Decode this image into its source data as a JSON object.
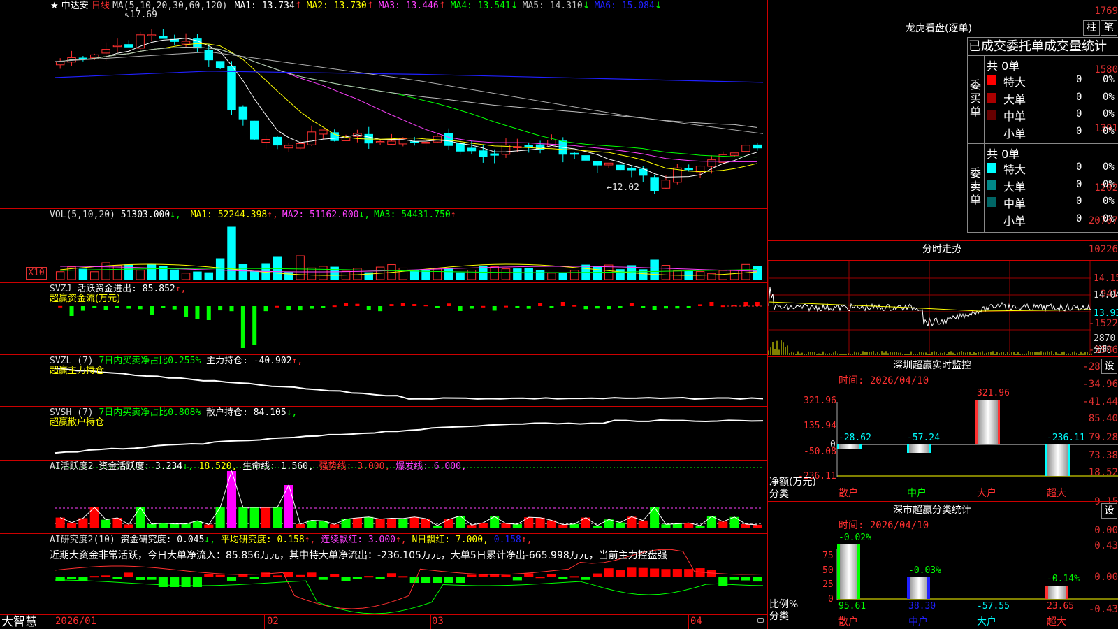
{
  "kline": {
    "star": "★",
    "stock_name": "中达安",
    "period": "日线",
    "ma_title": "MA(5,10,20,30,60,120)",
    "ma": [
      {
        "label": "MA1: 13.734",
        "arrow": "↑",
        "color": "#ffffff"
      },
      {
        "label": "MA2: 13.730",
        "arrow": "↑",
        "color": "#ffff00"
      },
      {
        "label": "MA3: 13.446",
        "arrow": "↑",
        "color": "#ff40ff"
      },
      {
        "label": "MA4: 13.541",
        "arrow": "↓",
        "color": "#00ff00"
      },
      {
        "label": "MA5: 14.310",
        "arrow": "↓",
        "color": "#c0c0c0"
      },
      {
        "label": "MA6: 15.084",
        "arrow": "↓",
        "color": "#2020ff"
      }
    ],
    "yaxis": [
      "1769",
      "1580",
      "1391",
      "1202"
    ],
    "high_mark": "17.69",
    "low_mark": "←12.02"
  },
  "vol": {
    "title": "VOL(5,10,20)",
    "value": "51303.000",
    "value_arrow": "↓,",
    "ma": [
      {
        "label": "MA1: 52244.398",
        "arrow": "↑,",
        "color": "#ffff00"
      },
      {
        "label": "MA2: 51162.000",
        "arrow": "↓,",
        "color": "#ff40ff"
      },
      {
        "label": "MA3: 54431.750",
        "arrow": "↑",
        "color": "#00ff00"
      }
    ],
    "yaxis": [
      "20707",
      "10226"
    ],
    "unit": "X10"
  },
  "svzj": {
    "title": "SVZJ",
    "label": "活跃资金进出: 85.852",
    "arrow": "↑,",
    "subtitle": "超赢资金流(万元)",
    "yaxis": [
      "941",
      "-1522",
      "-3986"
    ]
  },
  "svzl": {
    "title": "SVZL (7)",
    "ratio": "7日内买卖净占比0.255%",
    "label": "主力持仓: -40.902",
    "arrow": "↑,",
    "subtitle": "超赢主力持仓",
    "yaxis": [
      "-28.47",
      "-34.96",
      "-41.44"
    ]
  },
  "svsh": {
    "title": "SVSH (7)",
    "ratio": "7日内买卖净占比0.808%",
    "label": "散户持仓: 84.105",
    "arrow": "↓,",
    "subtitle": "超赢散户持仓",
    "yaxis": [
      "85.40",
      "79.28",
      "73.38"
    ]
  },
  "ai_active": {
    "title": "AI活跃度2",
    "fund": "资金活跃度: 3.234",
    "fund_arrow": "↓,",
    "v2": "18.520,",
    "life": "生命线: 1.560,",
    "strong": "强势线: 3.000,",
    "burst": "爆发线: 6.000,",
    "yaxis": [
      "18.52",
      "9.15",
      "0.00"
    ]
  },
  "ai_research": {
    "title": "AI研究度2(10)",
    "fund": "资金研究度: 0.045",
    "fund_arrow": "↓,",
    "avg": "平均研究度: 0.158",
    "avg_arrow": "↑,",
    "cont": "连续飘红: 3.000",
    "cont_arrow": "↑,",
    "n": "N日飘红: 7.000,",
    "last": "0.158",
    "last_arrow": "↑,",
    "desc": "近期大资金非常活跃，今日大单净流入：85.856万元，其中特大单净流出：-236.105万元，大单5日累计净出-665.998万元，当前主力控盘强",
    "yaxis": [
      "0.43",
      "0.00",
      "-0.43"
    ]
  },
  "bottom": {
    "app": "大智慧",
    "dates": [
      "2026/01",
      "02",
      "03",
      "04"
    ]
  },
  "lhb": {
    "title": "龙虎看盘(逐单)",
    "btn1": "柱",
    "btn2": "笔",
    "header": "已成交委托单成交量统计",
    "buy_label": "委买单",
    "sell_label": "委卖单",
    "buy_total": "共 0单",
    "sell_total": "共 0单",
    "buy_rows": [
      {
        "name": "特大",
        "count": "0",
        "pct": "0%",
        "color": "#ff0000"
      },
      {
        "name": "大单",
        "count": "0",
        "pct": "0%",
        "color": "#aa0000"
      },
      {
        "name": "中单",
        "count": "0",
        "pct": "0%",
        "color": "#660000"
      },
      {
        "name": "小单",
        "count": "0",
        "pct": "0%",
        "color": ""
      }
    ],
    "sell_rows": [
      {
        "name": "特大",
        "count": "0",
        "pct": "0%",
        "color": "#00ffff"
      },
      {
        "name": "大单",
        "count": "0",
        "pct": "0%",
        "color": "#008888"
      },
      {
        "name": "中单",
        "count": "0",
        "pct": "0%",
        "color": "#006666"
      },
      {
        "name": "小单",
        "count": "0",
        "pct": "0%",
        "color": ""
      }
    ]
  },
  "intraday": {
    "title": "分时走势",
    "yaxis": [
      "14.15",
      "14.04",
      "13.93"
    ],
    "vol": "2870",
    "vol_label": "分时"
  },
  "monitor": {
    "title": "深圳超赢实时监控",
    "btn": "设",
    "time": "时间: 2026/04/10",
    "yaxis": [
      "321.96",
      "135.94",
      "0",
      "-50.08",
      "-236.11"
    ],
    "bars": [
      {
        "name": "散户",
        "value": "-28.62"
      },
      {
        "name": "中户",
        "value": "-57.24"
      },
      {
        "name": "大户",
        "value": "321.96"
      },
      {
        "name": "超大",
        "value": "-236.11"
      }
    ],
    "left_label1": "净额(万元)",
    "left_label2": "分类"
  },
  "classify": {
    "title": "深市超赢分类统计",
    "btn": "设",
    "time": "时间: 2026/04/10",
    "yaxis": [
      "75",
      "50",
      "25",
      "0"
    ],
    "bars": [
      {
        "name": "散户",
        "pct": "-0.02%",
        "value": "95.61"
      },
      {
        "name": "中户",
        "pct": "-0.03%",
        "value": "38.30"
      },
      {
        "name": "大户",
        "pct": "",
        "value": "-57.55"
      },
      {
        "name": "超大",
        "pct": "-0.14%",
        "value": "23.65"
      }
    ],
    "left_label1": "比例%",
    "left_label2": "分类"
  }
}
